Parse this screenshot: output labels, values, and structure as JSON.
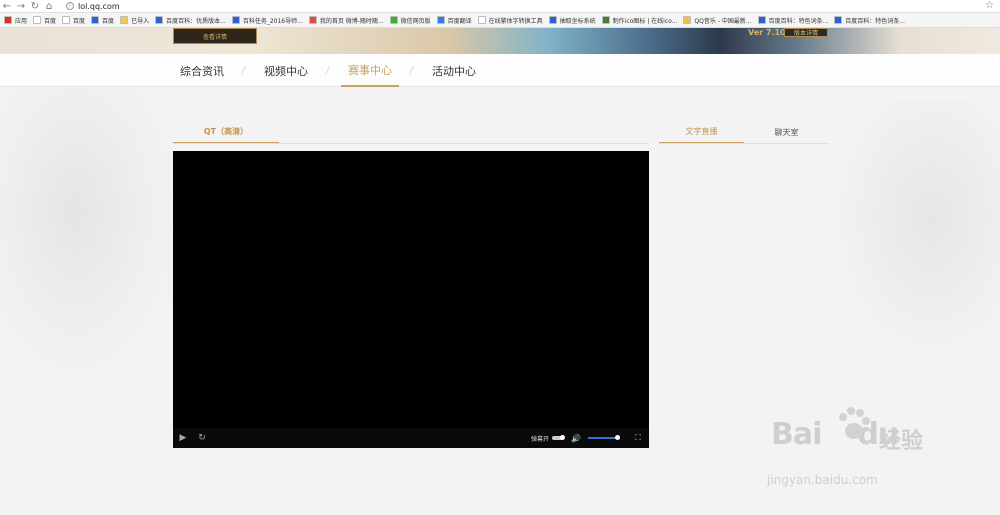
{
  "browser": {
    "url": "lol.qq.com",
    "bookmarks": [
      {
        "label": "应用",
        "color": "#d93025"
      },
      {
        "label": "百度",
        "color": "#ffffff"
      },
      {
        "label": "百度",
        "color": "#ffffff"
      },
      {
        "label": "百度",
        "color": "#2d5fd8"
      },
      {
        "label": "已导入",
        "color": "#f2c94c"
      },
      {
        "label": "百度百科：优质版本...",
        "color": "#2d5fd8"
      },
      {
        "label": "百科任务_2016导师...",
        "color": "#2d5fd8"
      },
      {
        "label": "我的首页 微博-随时随...",
        "color": "#e5483d"
      },
      {
        "label": "微信网页版",
        "color": "#3cb034"
      },
      {
        "label": "百度翻译",
        "color": "#2d7cf0"
      },
      {
        "label": "在线繁体字转换工具",
        "color": "#ffffff"
      },
      {
        "label": "抽取坐标系统",
        "color": "#2d5fd8"
      },
      {
        "label": "制作ico图标 | 在线ico...",
        "color": "#4a7b2e"
      },
      {
        "label": "QQ音乐 - 中国最新...",
        "color": "#f2c230"
      },
      {
        "label": "百度百科：特色词条...",
        "color": "#2d5fd8"
      },
      {
        "label": "百度百科：特色词条...",
        "color": "#2d5fd8"
      }
    ]
  },
  "banner": {
    "details_button": "查看详情",
    "version": "Ver 7.10",
    "version_button": "版本详情"
  },
  "nav": {
    "tabs": [
      "综合资讯",
      "视频中心",
      "赛事中心",
      "活动中心"
    ],
    "active_index": 2
  },
  "player": {
    "quality_tab": "QT（高清）",
    "danmu_label": "弹幕开",
    "volume_level": 0.85
  },
  "side_tabs": {
    "live_text": "文字直播",
    "chat_room": "聊天室"
  },
  "watermark": {
    "logo": "Bai",
    "logo2": "du",
    "cn": "经验",
    "url": "jingyan.baidu.com"
  },
  "colors": {
    "accent": "#c8a063",
    "background": "#f3f3f3",
    "player": "#000000"
  }
}
